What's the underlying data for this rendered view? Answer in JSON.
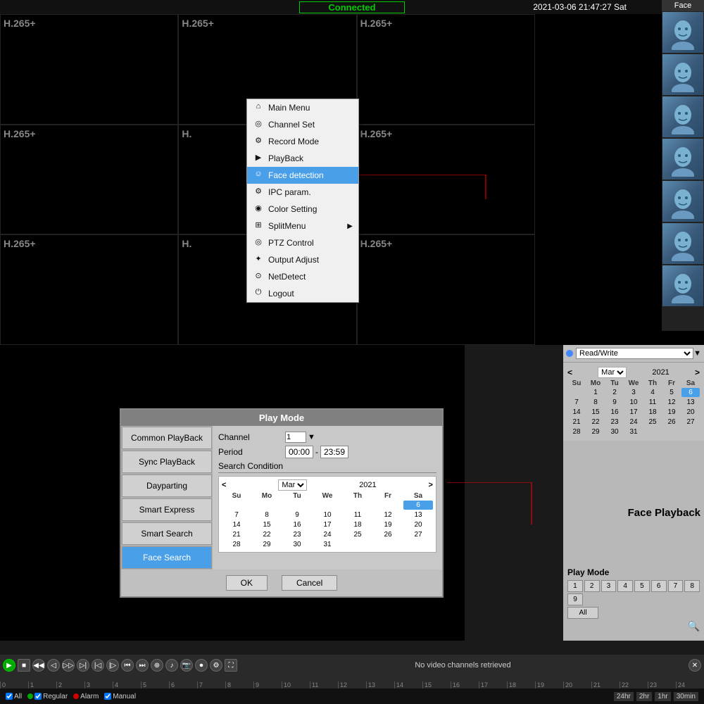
{
  "top": {
    "connected": "Connected",
    "datetime": "2021-03-06 21:47:27 Sat",
    "face_panel_title": "Face",
    "codec_labels": [
      "H.265+",
      "H.265+",
      "H.265+",
      "H.265+",
      "H.",
      "H.265+",
      "H.265+",
      "H.",
      "H.265+"
    ],
    "menu": {
      "items": [
        {
          "label": "Main Menu",
          "icon": "🏠",
          "active": false
        },
        {
          "label": "Channel Set",
          "icon": "🔍",
          "active": false
        },
        {
          "label": "Record Mode",
          "icon": "⚙",
          "active": false
        },
        {
          "label": "PlayBack",
          "icon": "▶",
          "active": false
        },
        {
          "label": "Face detection",
          "icon": "👤",
          "active": true
        },
        {
          "label": "IPC param.",
          "icon": "🔧",
          "active": false
        },
        {
          "label": "Color Setting",
          "icon": "⚙",
          "active": false
        },
        {
          "label": "SplitMenu",
          "icon": "⊞",
          "active": false,
          "has_arrow": true
        },
        {
          "label": "PTZ Control",
          "icon": "🎮",
          "active": false
        },
        {
          "label": "Output Adjust",
          "icon": "✨",
          "active": false
        },
        {
          "label": "NetDetect",
          "icon": "🌐",
          "active": false
        },
        {
          "label": "Logout",
          "icon": "⏻",
          "active": false
        }
      ]
    },
    "face_detection_label": "Face Detection"
  },
  "bottom": {
    "dialog": {
      "title": "Play Mode",
      "sidebar_items": [
        {
          "label": "Common PlayBack",
          "active": false
        },
        {
          "label": "Sync PlayBack",
          "active": false
        },
        {
          "label": "Dayparting",
          "active": false
        },
        {
          "label": "Smart Express",
          "active": false
        },
        {
          "label": "Smart Search",
          "active": false
        },
        {
          "label": "Face Search",
          "active": true
        }
      ],
      "channel_label": "Channel",
      "channel_value": "1",
      "period_label": "Period",
      "period_start": "00:00",
      "period_end": "23:59",
      "search_condition_label": "Search Condition",
      "calendar": {
        "month": "Mar",
        "year": "2021",
        "days_header": [
          "Su",
          "Mo",
          "Tu",
          "We",
          "Th",
          "Fr",
          "Sa"
        ],
        "weeks": [
          [
            "",
            "",
            "",
            "",
            "",
            "",
            "6"
          ],
          [
            "7",
            "8",
            "9",
            "10",
            "11",
            "12",
            "13"
          ],
          [
            "14",
            "15",
            "16",
            "17",
            "18",
            "19",
            "20"
          ],
          [
            "21",
            "22",
            "23",
            "24",
            "25",
            "26",
            "27"
          ],
          [
            "28",
            "29",
            "30",
            "31",
            "",
            "",
            ""
          ]
        ],
        "selected": "6"
      },
      "ok_label": "OK",
      "cancel_label": "Cancel"
    },
    "right_panel": {
      "read_write_label": "Read/Write",
      "calendar": {
        "month": "Mar",
        "year": "2021",
        "days_header": [
          "Su",
          "Mo",
          "Tu",
          "We",
          "Th",
          "Fr",
          "Sa"
        ],
        "weeks": [
          [
            "",
            "1",
            "2",
            "3",
            "4",
            "5",
            "6"
          ],
          [
            "7",
            "8",
            "9",
            "10",
            "11",
            "12",
            "13"
          ],
          [
            "14",
            "15",
            "16",
            "17",
            "18",
            "19",
            "20"
          ],
          [
            "21",
            "22",
            "23",
            "24",
            "25",
            "26",
            "27"
          ],
          [
            "28",
            "29",
            "30",
            "31",
            "",
            "",
            ""
          ]
        ],
        "selected": "6"
      },
      "play_mode_title": "Play Mode",
      "play_mode_nums": [
        "1",
        "2",
        "3",
        "4",
        "5",
        "6",
        "7",
        "8",
        "9"
      ],
      "play_mode_all": "All",
      "face_playback_label": "Face Playback"
    },
    "controls": {
      "status": "No video channels retrieved"
    },
    "timeline": {
      "ticks": [
        "0",
        "1",
        "2",
        "3",
        "4",
        "5",
        "6",
        "7",
        "8",
        "9",
        "10",
        "11",
        "12",
        "13",
        "14",
        "15",
        "16",
        "17",
        "18",
        "19",
        "20",
        "21",
        "22",
        "23",
        "24"
      ],
      "options": [
        "All",
        "Regular",
        "Alarm",
        "Manual"
      ],
      "time_buttons": [
        "24hr",
        "2hr",
        "1hr",
        "30min"
      ]
    }
  }
}
